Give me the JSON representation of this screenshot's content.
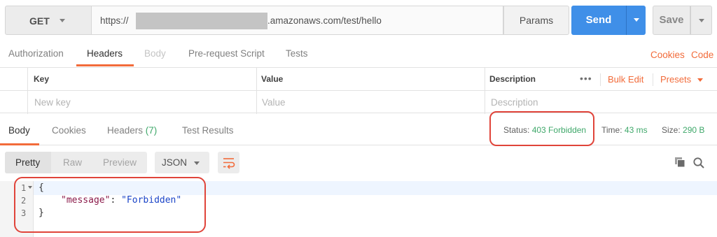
{
  "request": {
    "method": "GET",
    "url_scheme": "https://",
    "url_rest": ".amazonaws.com/test/hello",
    "params_label": "Params",
    "send_label": "Send",
    "save_label": "Save"
  },
  "request_tabs": {
    "authorization": "Authorization",
    "headers": "Headers",
    "body": "Body",
    "prerequest": "Pre-request Script",
    "tests": "Tests",
    "cookies": "Cookies",
    "code": "Code"
  },
  "headers_table": {
    "key_col": "Key",
    "value_col": "Value",
    "desc_col": "Description",
    "more": "•••",
    "bulk_edit": "Bulk Edit",
    "presets": "Presets",
    "key_placeholder": "New key",
    "value_placeholder": "Value",
    "desc_placeholder": "Description"
  },
  "response_tabs": {
    "body": "Body",
    "cookies": "Cookies",
    "headers": "Headers",
    "headers_count": "(7)",
    "test_results": "Test Results"
  },
  "response_meta": {
    "status_label": "Status:",
    "status_value": "403 Forbidden",
    "time_label": "Time:",
    "time_value": "43 ms",
    "size_label": "Size:",
    "size_value": "290 B"
  },
  "response_toolbar": {
    "pretty": "Pretty",
    "raw": "Raw",
    "preview": "Preview",
    "format": "JSON"
  },
  "response_body": {
    "line_numbers": [
      "1",
      "2",
      "3"
    ],
    "open_brace": "{",
    "key": "\"message\"",
    "colon": ": ",
    "value": "\"Forbidden\"",
    "close_brace": "}"
  },
  "colors": {
    "accent_orange": "#f26b3a",
    "send_blue": "#3f8fe8",
    "success_green": "#3fa86a",
    "annotation_red": "#e0443a"
  },
  "icons": [
    "chevron-down-icon",
    "wrap-lines-icon",
    "copy-icon",
    "search-icon"
  ]
}
